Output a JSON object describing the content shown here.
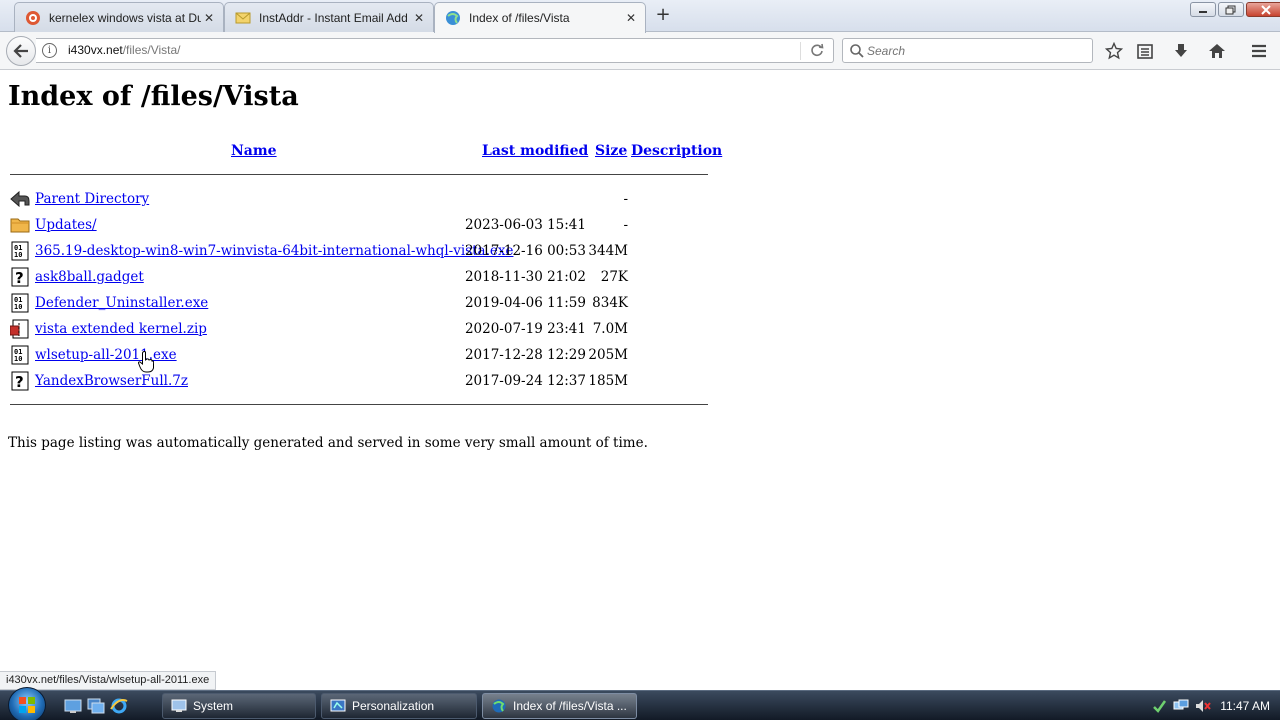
{
  "browser": {
    "tabs": [
      {
        "title": "kernelex windows vista at Du",
        "favicon": "duckduckgo-icon",
        "active": false
      },
      {
        "title": "InstAddr - Instant Email Add",
        "favicon": "mail-icon",
        "active": false
      },
      {
        "title": "Index of /files/Vista",
        "favicon": "globe-icon",
        "active": true
      }
    ],
    "url": {
      "host": "i430vx.net",
      "path": "/files/Vista/"
    },
    "search_placeholder": "Search"
  },
  "page": {
    "title": "Index of /files/Vista",
    "columns": {
      "name": "Name",
      "last_modified": "Last modified",
      "size": "Size",
      "description": "Description"
    },
    "rows": [
      {
        "icon": "back-arrow-icon",
        "name": "Parent Directory",
        "modified": "",
        "size": "-"
      },
      {
        "icon": "folder-icon",
        "name": "Updates/",
        "modified": "2023-06-03 15:41",
        "size": "-"
      },
      {
        "icon": "binary-file-icon",
        "name": "365.19-desktop-win8-win7-winvista-64bit-international-whql-vista.exe",
        "modified": "2017-12-16 00:53",
        "size": "344M"
      },
      {
        "icon": "unknown-file-icon",
        "name": "ask8ball.gadget",
        "modified": "2018-11-30 21:02",
        "size": "27K"
      },
      {
        "icon": "binary-file-icon",
        "name": "Defender_Uninstaller.exe",
        "modified": "2019-04-06 11:59",
        "size": "834K"
      },
      {
        "icon": "compressed-file-icon",
        "name": "vista extended kernel.zip",
        "modified": "2020-07-19 23:41",
        "size": "7.0M"
      },
      {
        "icon": "binary-file-icon",
        "name": "wlsetup-all-2011.exe",
        "modified": "2017-12-28 12:29",
        "size": "205M"
      },
      {
        "icon": "unknown-file-icon",
        "name": "YandexBrowserFull.7z",
        "modified": "2017-09-24 12:37",
        "size": "185M"
      }
    ],
    "footer": "This page listing was automatically generated and served in some very small amount of time."
  },
  "status_bar": {
    "text": "i430vx.net/files/Vista/wlsetup-all-2011.exe"
  },
  "taskbar": {
    "tasks": [
      {
        "label": "System",
        "active": false
      },
      {
        "label": "Personalization",
        "active": false
      },
      {
        "label": "Index of /files/Vista ...",
        "active": true
      }
    ],
    "clock": "11:47 AM"
  }
}
